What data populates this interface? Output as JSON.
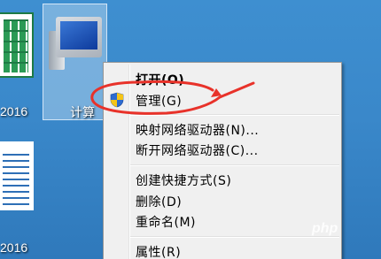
{
  "desktop": {
    "excel_label": "2016",
    "word_label": "2016",
    "computer_label": "计算"
  },
  "context_menu": {
    "items": [
      {
        "label": "打开(O)",
        "bold": true
      },
      {
        "label": "管理(G)"
      },
      {
        "label": "映射网络驱动器(N)..."
      },
      {
        "label": "断开网络驱动器(C)..."
      },
      {
        "label": "创建快捷方式(S)"
      },
      {
        "label": "删除(D)"
      },
      {
        "label": "重命名(M)"
      },
      {
        "label": "属性(R)"
      }
    ]
  },
  "annotation": {
    "color": "#e8322a"
  },
  "watermark": {
    "text": "php"
  }
}
